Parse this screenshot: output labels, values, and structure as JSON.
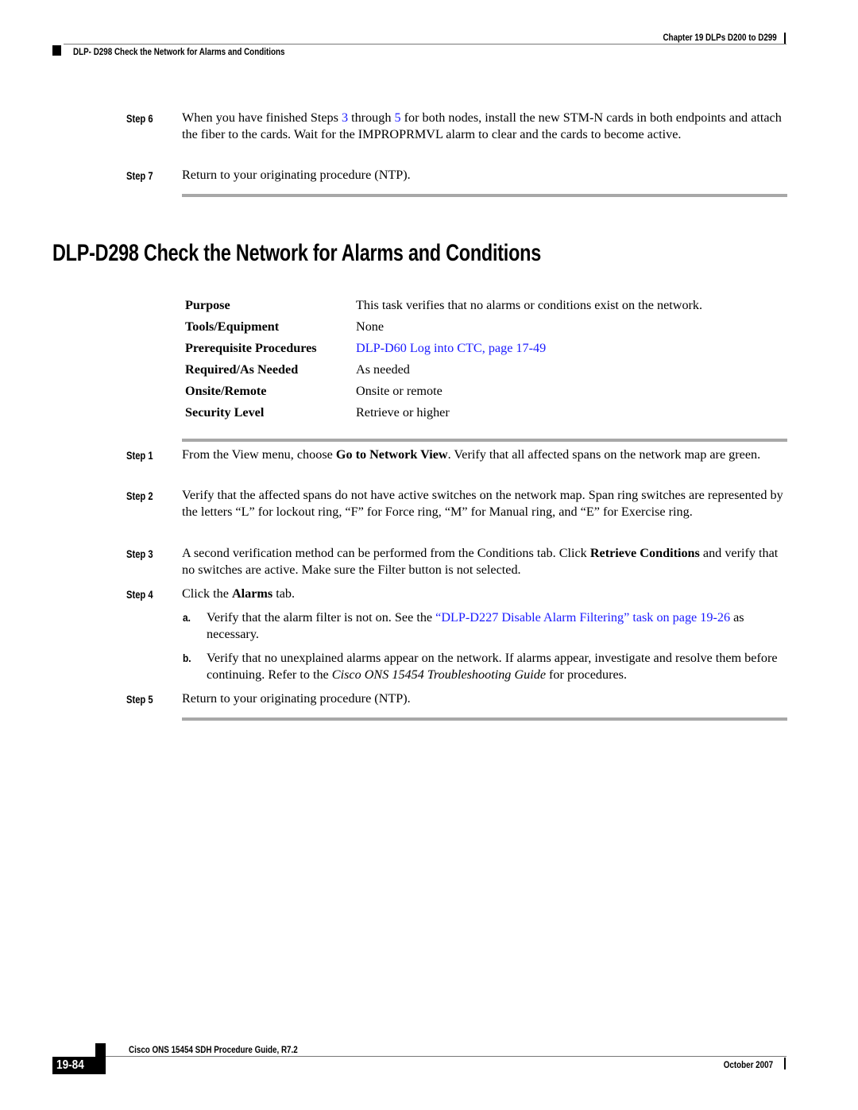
{
  "header": {
    "chapter": "Chapter 19 DLPs D200 to D299",
    "section": "DLP- D298 Check the Network for Alarms and Conditions"
  },
  "prev_steps": [
    {
      "label": "Step 6",
      "parts": [
        "When you have finished Steps ",
        "3",
        " through ",
        "5",
        " for both nodes, install the new STM-N cards in both endpoints and attach the fiber to the cards. Wait for the IMPROPRMVL alarm to clear and the cards to become active."
      ]
    },
    {
      "label": "Step 7",
      "text": "Return to your originating procedure (NTP)."
    }
  ],
  "title": "DLP-D298 Check the Network for Alarms and Conditions",
  "properties": [
    {
      "key": "Purpose",
      "value": "This task verifies that no alarms or conditions exist on the network."
    },
    {
      "key": "Tools/Equipment",
      "value": "None"
    },
    {
      "key": "Prerequisite Procedures",
      "value": "DLP-D60 Log into CTC, page 17-49",
      "is_link": true
    },
    {
      "key": "Required/As Needed",
      "value": "As needed"
    },
    {
      "key": "Onsite/Remote",
      "value": "Onsite or remote"
    },
    {
      "key": "Security Level",
      "value": "Retrieve or higher"
    }
  ],
  "steps": [
    {
      "label": "Step 1",
      "pre": "From the View menu, choose ",
      "bold": "Go to Network View",
      "post": ". Verify that all affected spans on the network map are green."
    },
    {
      "label": "Step 2",
      "text": "Verify that the affected spans do not have active switches on the network map. Span ring switches are represented by the letters “L” for lockout ring, “F” for Force ring, “M” for Manual ring, and “E” for Exercise ring."
    },
    {
      "label": "Step 3",
      "pre": "A second verification method can be performed from the Conditions tab. Click ",
      "bold": "Retrieve Conditions",
      "post": " and verify that no switches are active. Make sure the Filter button is not selected."
    },
    {
      "label": "Step 4",
      "pre": "Click the ",
      "bold": "Alarms",
      "post": " tab.",
      "substeps": [
        {
          "label": "a.",
          "pre": "Verify that the alarm filter is not on. See the ",
          "link": "“DLP-D227 Disable Alarm Filtering” task on page 19-26",
          "post": " as necessary."
        },
        {
          "label": "b.",
          "pre": "Verify that no unexplained alarms appear on the network. If alarms appear, investigate and resolve them before continuing. Refer to the ",
          "italic": "Cisco ONS 15454 Troubleshooting Guide",
          "post": " for procedures."
        }
      ]
    },
    {
      "label": "Step 5",
      "text": "Return to your originating procedure (NTP)."
    }
  ],
  "footer": {
    "guide_title": "Cisco ONS 15454 SDH Procedure Guide, R7.2",
    "page_number": "19-84",
    "date": "October 2007"
  },
  "colors": {
    "link": "#1a1aff",
    "rule": "#a8a8a8"
  }
}
